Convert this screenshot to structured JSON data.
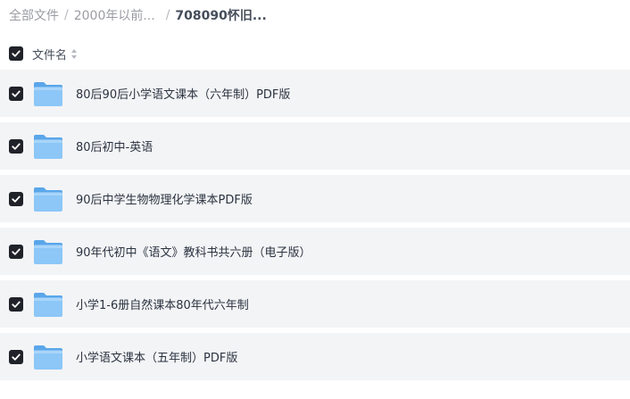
{
  "breadcrumb": {
    "items": [
      "全部文件",
      "2000年以前...",
      "708090怀旧..."
    ],
    "separator": "/"
  },
  "header": {
    "column_label": "文件名"
  },
  "colors": {
    "row_bg": "#f3f4f6",
    "checkbox": "#1f2329",
    "folder": "#7dbef5"
  },
  "files": [
    {
      "name": "80后90后小学语文课本（六年制）PDF版",
      "checked": true,
      "icon": "folder-icon"
    },
    {
      "name": "80后初中-英语",
      "checked": true,
      "icon": "folder-icon"
    },
    {
      "name": "90后中学生物物理化学课本PDF版",
      "checked": true,
      "icon": "folder-icon"
    },
    {
      "name": "90年代初中《语文》教科书共六册（电子版）",
      "checked": true,
      "icon": "folder-icon"
    },
    {
      "name": "小学1-6册自然课本80年代六年制",
      "checked": true,
      "icon": "folder-icon"
    },
    {
      "name": "小学语文课本（五年制）PDF版",
      "checked": true,
      "icon": "folder-icon"
    }
  ]
}
